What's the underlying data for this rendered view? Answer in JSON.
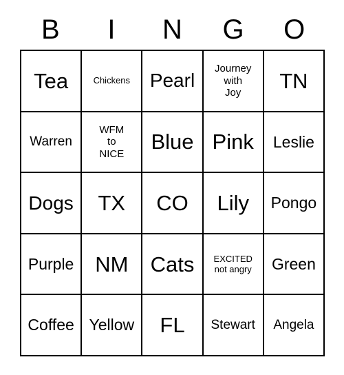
{
  "card": {
    "header": {
      "letters": [
        "B",
        "I",
        "N",
        "G",
        "O"
      ]
    },
    "rows": [
      [
        {
          "text": "Tea",
          "size": "xl"
        },
        {
          "text": "Chickens",
          "size": "xxs"
        },
        {
          "text": "Pearl",
          "size": "lg"
        },
        {
          "text": "Journey\nwith\nJoy",
          "size": "xs"
        },
        {
          "text": "TN",
          "size": "xl"
        }
      ],
      [
        {
          "text": "Warren",
          "size": "sm"
        },
        {
          "text": "WFM\nto\nNICE",
          "size": "xs"
        },
        {
          "text": "Blue",
          "size": "xl"
        },
        {
          "text": "Pink",
          "size": "xl"
        },
        {
          "text": "Leslie",
          "size": "md"
        }
      ],
      [
        {
          "text": "Dogs",
          "size": "lg"
        },
        {
          "text": "TX",
          "size": "xl"
        },
        {
          "text": "CO",
          "size": "xl"
        },
        {
          "text": "Lily",
          "size": "xl"
        },
        {
          "text": "Pongo",
          "size": "md"
        }
      ],
      [
        {
          "text": "Purple",
          "size": "md"
        },
        {
          "text": "NM",
          "size": "xl"
        },
        {
          "text": "Cats",
          "size": "xl"
        },
        {
          "text": "EXCITED\nnot angry",
          "size": "xxs"
        },
        {
          "text": "Green",
          "size": "md"
        }
      ],
      [
        {
          "text": "Coffee",
          "size": "md"
        },
        {
          "text": "Yellow",
          "size": "md"
        },
        {
          "text": "FL",
          "size": "xl"
        },
        {
          "text": "Stewart",
          "size": "sm"
        },
        {
          "text": "Angela",
          "size": "sm"
        }
      ]
    ]
  },
  "colors": {
    "background": "#ffffff",
    "border": "#000000",
    "text": "#000000"
  }
}
